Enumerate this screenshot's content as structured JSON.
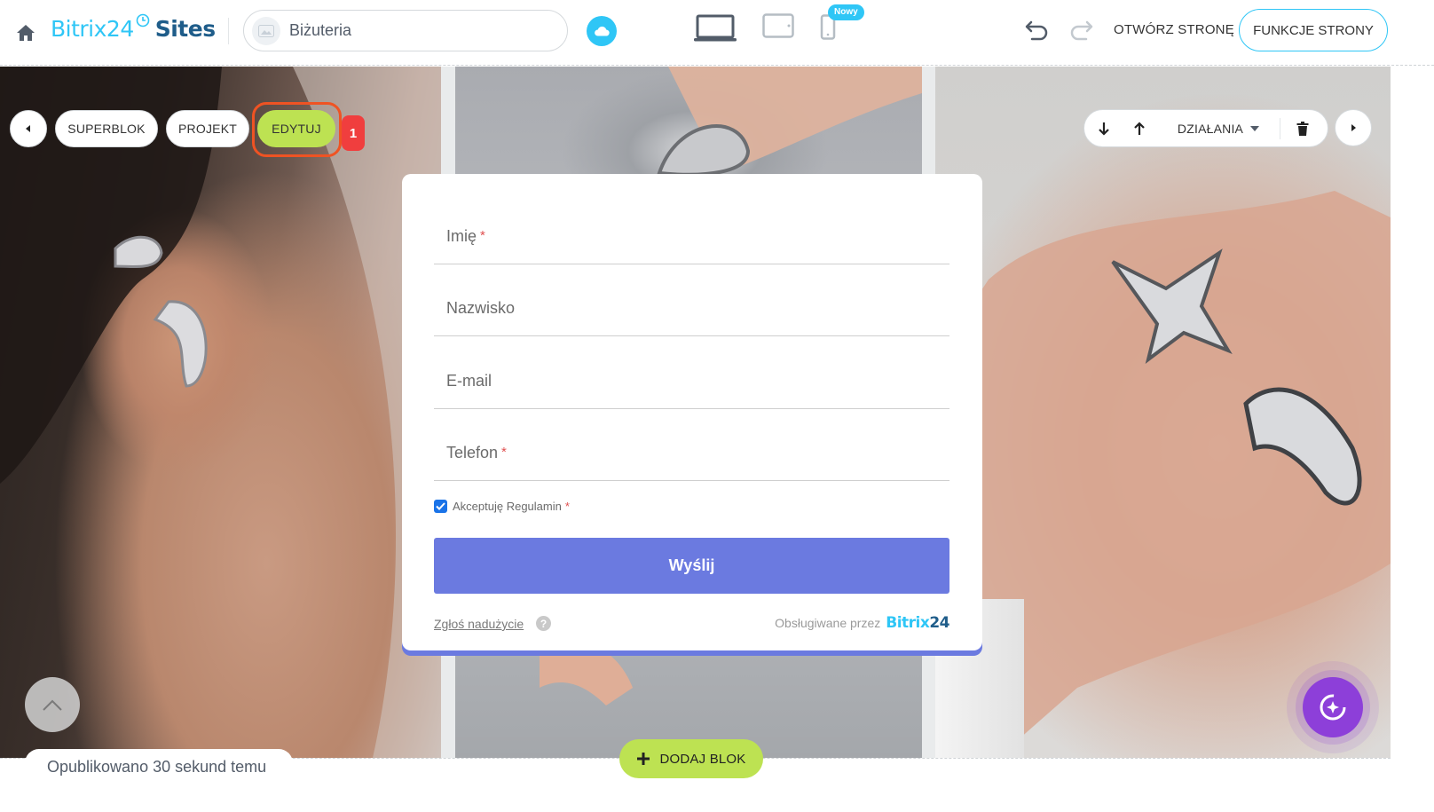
{
  "header": {
    "logo_brand": "Bitrix24",
    "logo_product": "Sites",
    "site_name": "Biżuteria",
    "new_badge": "Nowy",
    "open_page": "OTWÓRZ STRONĘ",
    "page_functions": "FUNKCJE STRONY"
  },
  "block_toolbar": {
    "superblock": "SUPERBLOK",
    "design": "PROJEKT",
    "edit": "EDYTUJ",
    "step_number": "1",
    "actions": "DZIAŁANIA"
  },
  "form": {
    "fields": [
      {
        "label": "Imię",
        "required": "*"
      },
      {
        "label": "Nazwisko",
        "required": ""
      },
      {
        "label": "E-mail",
        "required": ""
      },
      {
        "label": "Telefon",
        "required": "*"
      }
    ],
    "consent_label": "Akceptuję Regulamin",
    "consent_required": "*",
    "consent_checked": true,
    "submit": "Wyślij",
    "report_abuse": "Zgłoś nadużycie",
    "help": "?",
    "powered_by": "Obsługiwane przez",
    "powered_brand": "Bitrix",
    "powered_brand_num": "24"
  },
  "footer": {
    "status": "Opublikowano 30 sekund temu",
    "add_block": "DODAJ BLOK"
  },
  "colors": {
    "accent": "#2fc6f6",
    "edit_green": "#bde252",
    "highlight_border": "#ef5323",
    "submit_bg": "#6b7ae0",
    "copilot": "#8d3fd9"
  }
}
